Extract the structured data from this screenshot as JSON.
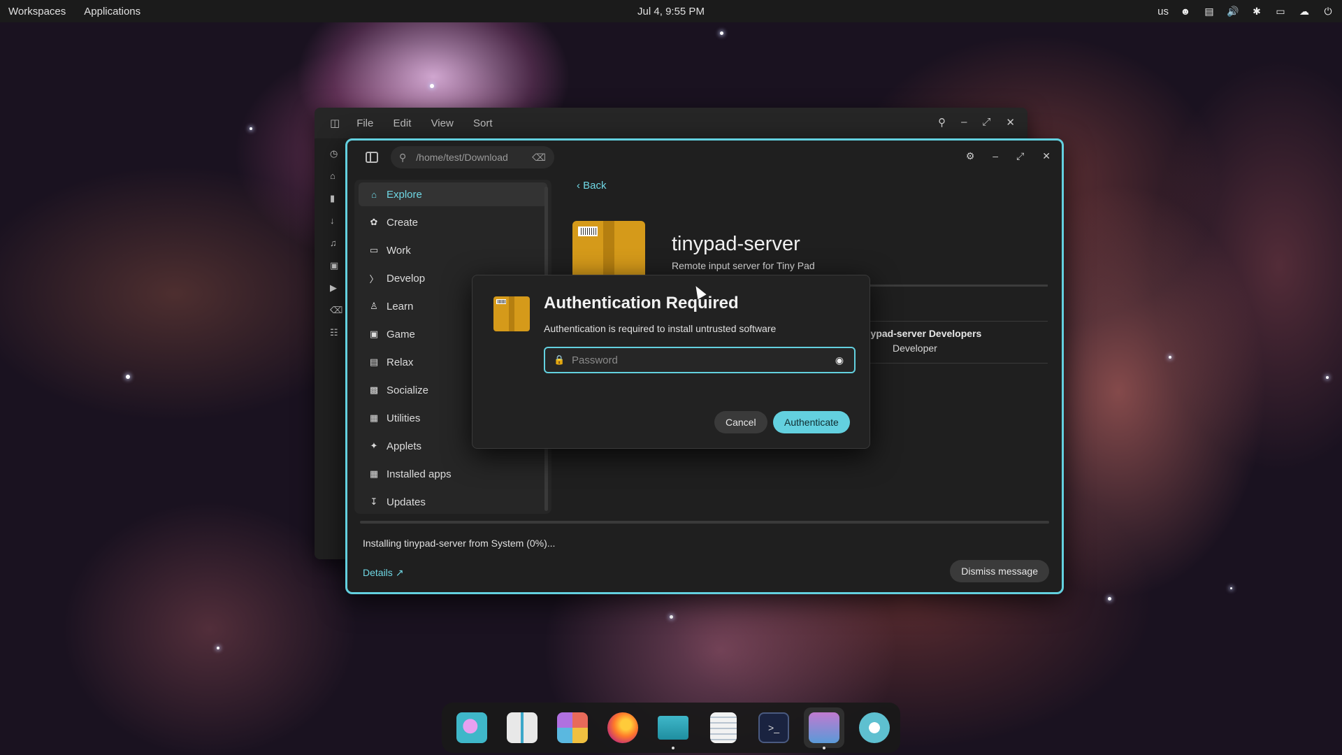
{
  "topbar": {
    "workspaces": "Workspaces",
    "applications": "Applications",
    "clock": "Jul 4, 9:55 PM",
    "keyboard_layout": "us",
    "tray_icons": [
      "accessibility-icon",
      "display-icon",
      "volume-icon",
      "bluetooth-off-icon",
      "battery-icon",
      "network-icon",
      "power-icon"
    ]
  },
  "files_window": {
    "menu": [
      "File",
      "Edit",
      "View",
      "Sort"
    ]
  },
  "store_window": {
    "search_path": "/home/test/Download",
    "nav": [
      {
        "label": "Explore",
        "icon": "home-icon",
        "active": true
      },
      {
        "label": "Create",
        "icon": "palette-icon"
      },
      {
        "label": "Work",
        "icon": "laptop-icon"
      },
      {
        "label": "Develop",
        "icon": "terminal-icon"
      },
      {
        "label": "Learn",
        "icon": "person-icon"
      },
      {
        "label": "Game",
        "icon": "gamepad-icon"
      },
      {
        "label": "Relax",
        "icon": "image-icon"
      },
      {
        "label": "Socialize",
        "icon": "chat-icon"
      },
      {
        "label": "Utilities",
        "icon": "calculator-icon"
      },
      {
        "label": "Applets",
        "icon": "applet-icon"
      },
      {
        "label": "Installed apps",
        "icon": "grid-icon"
      },
      {
        "label": "Updates",
        "icon": "download-icon"
      }
    ],
    "back_label": "Back",
    "app_name": "tinypad-server",
    "app_summary": "Remote input server for Tiny Pad",
    "developer_name": "nypad-server Developers",
    "developer_role": "Developer",
    "status_text": "Installing tinypad-server from System (0%)...",
    "install_progress_percent": 0,
    "details_label": "Details",
    "dismiss_label": "Dismiss message"
  },
  "auth_dialog": {
    "title": "Authentication Required",
    "message": "Authentication is required to install untrusted software",
    "password_placeholder": "Password",
    "password_value": "",
    "cancel_label": "Cancel",
    "authenticate_label": "Authenticate"
  },
  "dock": {
    "apps": [
      "search-launcher",
      "workspaces",
      "app-grid",
      "firefox",
      "files",
      "text-editor",
      "terminal",
      "app-store",
      "settings"
    ],
    "accent": "#63d0df"
  }
}
